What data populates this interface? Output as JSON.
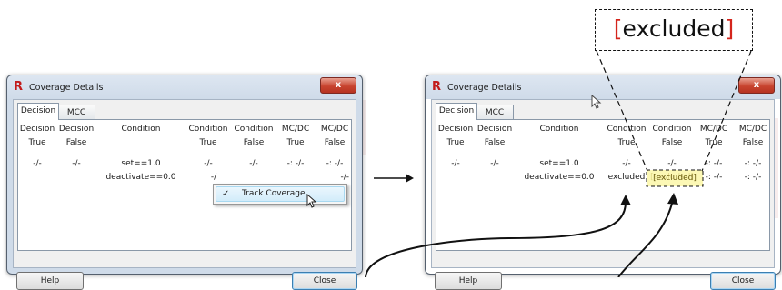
{
  "dialog": {
    "title": "Coverage Details",
    "close_glyph": "x",
    "app_icon": "R",
    "tabs": [
      {
        "label": "Decision"
      },
      {
        "label": "MCC"
      }
    ],
    "headers": [
      {
        "l1": "Decision",
        "l2": "True"
      },
      {
        "l1": "Decision",
        "l2": "False"
      },
      {
        "l1": "Condition",
        "l2": ""
      },
      {
        "l1": "Condition",
        "l2": "True"
      },
      {
        "l1": "Condition",
        "l2": "False"
      },
      {
        "l1": "MC/DC",
        "l2": "True"
      },
      {
        "l1": "MC/DC",
        "l2": "False"
      }
    ],
    "help_label": "Help",
    "close_label": "Close"
  },
  "before": {
    "row1": [
      "-/-",
      "-/-",
      "set==1.0",
      "-/-",
      "-/-",
      "-: -/-",
      "-: -/-"
    ],
    "row2_condition": "deactivate==0.0",
    "row2_partial": [
      "-/",
      "-/-"
    ],
    "context_menu": {
      "check": "✓",
      "label": "Track Coverage"
    }
  },
  "after": {
    "row1": [
      "-/-",
      "-/-",
      "set==1.0",
      "-/-",
      "-/-",
      "-: -/-",
      "-: -/-"
    ],
    "row2": [
      "deactivate==0.0",
      "excluded",
      "[excluded]",
      "-: -/-",
      "-: -/-"
    ]
  },
  "callout": {
    "open": "[",
    "text": "excluded",
    "close": "]"
  },
  "colors": {
    "accent_red": "#d4251c",
    "highlight": "#fbf6a3",
    "dialog_frame": "#cfdbe9"
  },
  "icons": [
    "r-app-icon",
    "close-icon",
    "check-icon",
    "cursor-icon",
    "arrow-right-icon"
  ]
}
